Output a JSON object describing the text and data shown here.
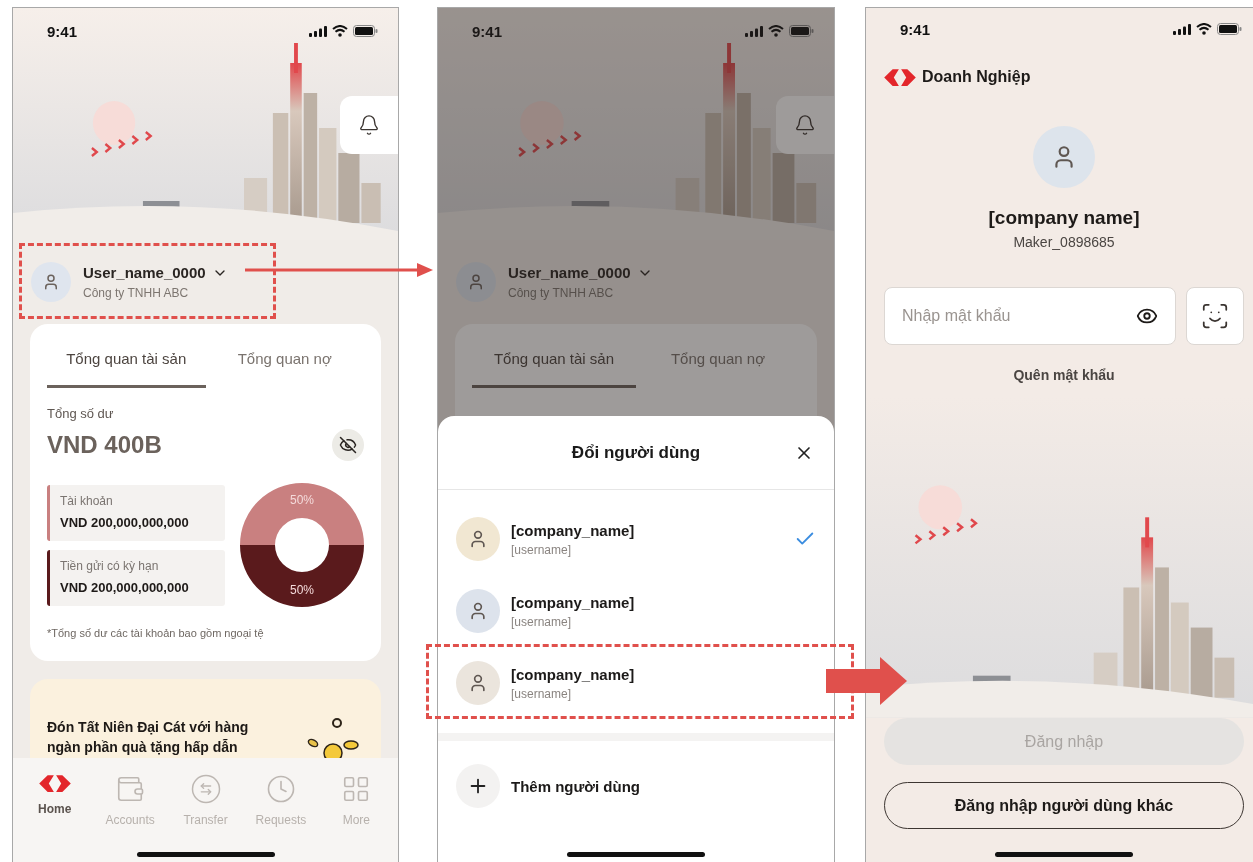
{
  "home_screen": {
    "status_time": "9:41",
    "user": {
      "name": "User_name_0000",
      "company": "Công ty TNHH ABC",
      "highlighted": true
    },
    "tabs": [
      {
        "label": "Tổng quan tài sản",
        "selected": true
      },
      {
        "label": "Tổng quan nợ",
        "selected": false
      }
    ],
    "balance_label": "Tổng số dư",
    "balance": "VND 400B",
    "accounts": [
      {
        "label": "Tài khoản",
        "amount": "VND 200,000,000,000",
        "color": "#c98080"
      },
      {
        "label": "Tiền gửi có kỳ hạn",
        "amount": "VND 200,000,000,000",
        "color": "#5a1a1c"
      }
    ],
    "chart_data": {
      "type": "donut",
      "values": [
        50,
        50
      ],
      "value_labels": [
        "50%",
        "50%"
      ]
    },
    "footnote": "*Tổng số dư các tài khoản bao gồm ngoại tệ",
    "promo": "Đón Tất Niên Đại Cát với hàng ngàn phần quà tặng hấp dẫn",
    "nav": [
      {
        "label": "Home",
        "kind": "logo",
        "selected": true
      },
      {
        "label": "Accounts",
        "kind": "wallet",
        "selected": false
      },
      {
        "label": "Transfer",
        "kind": "transfer",
        "selected": false
      },
      {
        "label": "Requests",
        "kind": "clock",
        "selected": false
      },
      {
        "label": "More",
        "kind": "grid",
        "selected": false
      }
    ]
  },
  "switch_screen": {
    "status_time": "9:41",
    "user": {
      "name": "User_name_0000",
      "company": "Công ty TNHH ABC"
    },
    "tabs": [
      {
        "label": "Tổng quan tài sản",
        "selected": true
      },
      {
        "label": "Tổng quan nợ",
        "selected": false
      }
    ],
    "sheet": {
      "title": "Đổi người dùng",
      "users": [
        {
          "company": "[company_name]",
          "username": "[username]",
          "color": "#f1e7d2",
          "selected": true
        },
        {
          "company": "[company_name]",
          "username": "[username]",
          "color": "#dde3ec",
          "selected": false
        },
        {
          "company": "[company_name]",
          "username": "[username]",
          "color": "#ebe5dd",
          "selected": false,
          "highlighted": true
        }
      ],
      "add_label": "Thêm người dùng"
    }
  },
  "login_screen": {
    "status_time": "9:41",
    "brand": "Doanh Nghiệp",
    "company": "[company name]",
    "username": "Maker_0898685",
    "password": {
      "placeholder": "Nhập mật khẩu"
    },
    "forgot_link": "Quên mật khẩu",
    "login_button": {
      "label": "Đăng nhập",
      "disabled": true
    },
    "switch_button": "Đăng nhập người dùng khác"
  }
}
